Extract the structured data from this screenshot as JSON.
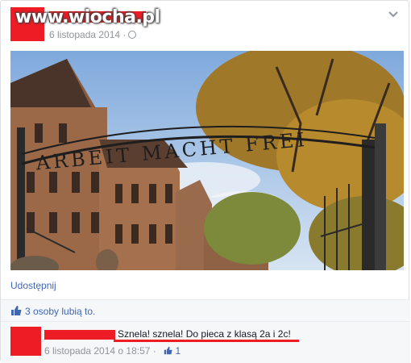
{
  "watermark": "www.wiocha.pl",
  "post": {
    "date": "6 listopada 2014 ·",
    "share_label": "Udostępnij",
    "photo_sign_text": "ARBEIT MACHT FREI"
  },
  "likes": {
    "text": "3 osoby lubią to."
  },
  "comment": {
    "text": "Sznela! sznela! Do pieca z klasą 2a i 2c!",
    "timestamp": "6 listopada 2014 o 18:57 ·",
    "like_count": "1"
  },
  "colors": {
    "redaction": "#ee1c25",
    "link": "#4267b2",
    "meta": "#90949c"
  }
}
